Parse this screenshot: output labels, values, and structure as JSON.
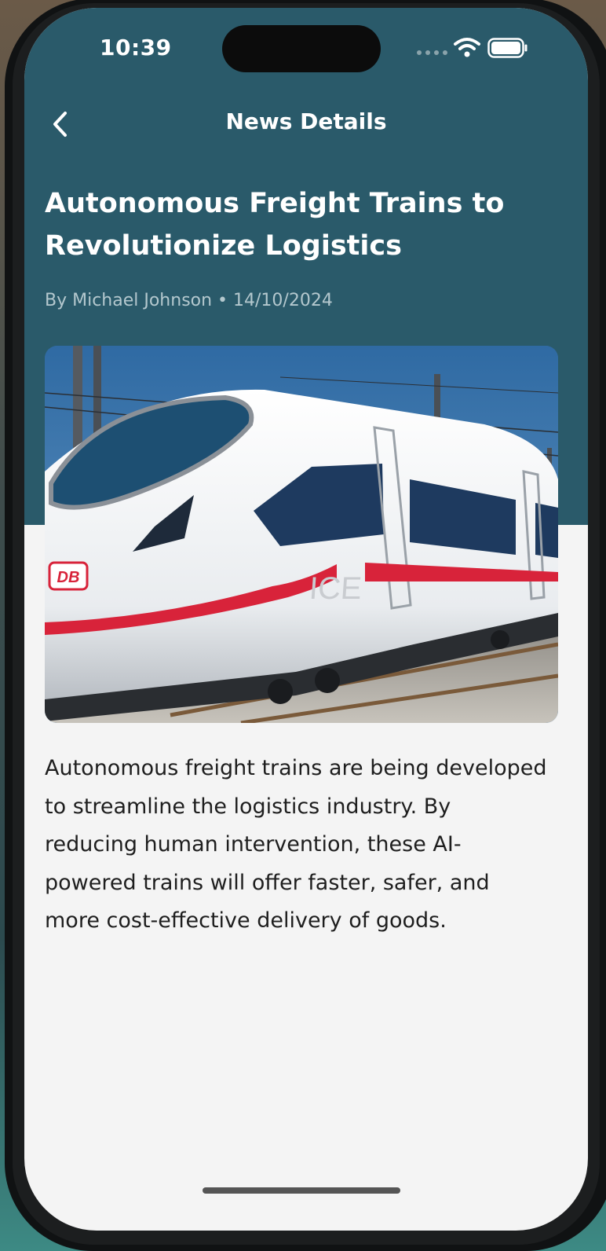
{
  "status_bar": {
    "time": "10:39",
    "icons": [
      "signal-dots-icon",
      "wifi-icon",
      "battery-icon"
    ]
  },
  "nav": {
    "back_icon": "chevron-left-icon",
    "title": "News Details"
  },
  "article": {
    "title": "Autonomous Freight Trains to Revolutionize Logistics",
    "meta": "By Michael Johnson • 14/10/2024",
    "image_labels": {
      "logo": "DB",
      "model": "ICE"
    },
    "body": "Autonomous freight trains are being developed to streamline the logistics industry. By reducing human intervention, these AI-powered trains will offer faster, safer, and more cost-effective delivery of goods."
  },
  "colors": {
    "header": "#2a5a6a",
    "background": "#f4f4f4",
    "text": "#1e1e1e",
    "meta_text": "#b4c8ce",
    "accent_red": "#d8233a"
  }
}
